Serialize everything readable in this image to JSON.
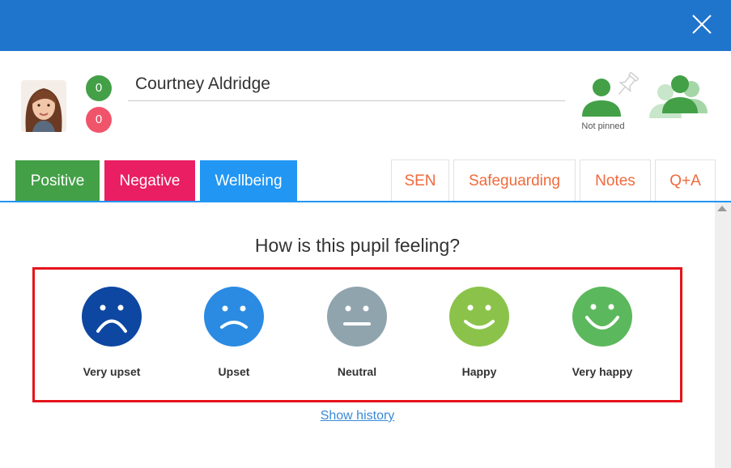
{
  "header": {
    "close_icon": "close-icon"
  },
  "pupil": {
    "name": "Courtney Aldridge",
    "positive_count": "0",
    "negative_count": "0",
    "pin_status": "Not pinned"
  },
  "tabs": [
    {
      "label": "Positive",
      "color": "#43a047"
    },
    {
      "label": "Negative",
      "color": "#e91e63"
    },
    {
      "label": "Wellbeing",
      "color": "#2196f3"
    },
    {
      "label": "SEN"
    },
    {
      "label": "Safeguarding"
    },
    {
      "label": "Notes"
    },
    {
      "label": "Q+A"
    }
  ],
  "wellbeing": {
    "question": "How is this pupil feeling?",
    "moods": [
      {
        "label": "Very upset",
        "icon": "very-sad-face-icon",
        "color": "#0d47a1"
      },
      {
        "label": "Upset",
        "icon": "sad-face-icon",
        "color": "#2b8be3"
      },
      {
        "label": "Neutral",
        "icon": "neutral-face-icon",
        "color": "#90a4ae"
      },
      {
        "label": "Happy",
        "icon": "happy-face-icon",
        "color": "#8bc34a"
      },
      {
        "label": "Very happy",
        "icon": "very-happy-face-icon",
        "color": "#5cb85c"
      }
    ],
    "history_link": "Show history"
  },
  "colors": {
    "accent": "#1f74cc",
    "outline_tab_text": "#ef6a3c",
    "highlight": "#e5141b"
  }
}
